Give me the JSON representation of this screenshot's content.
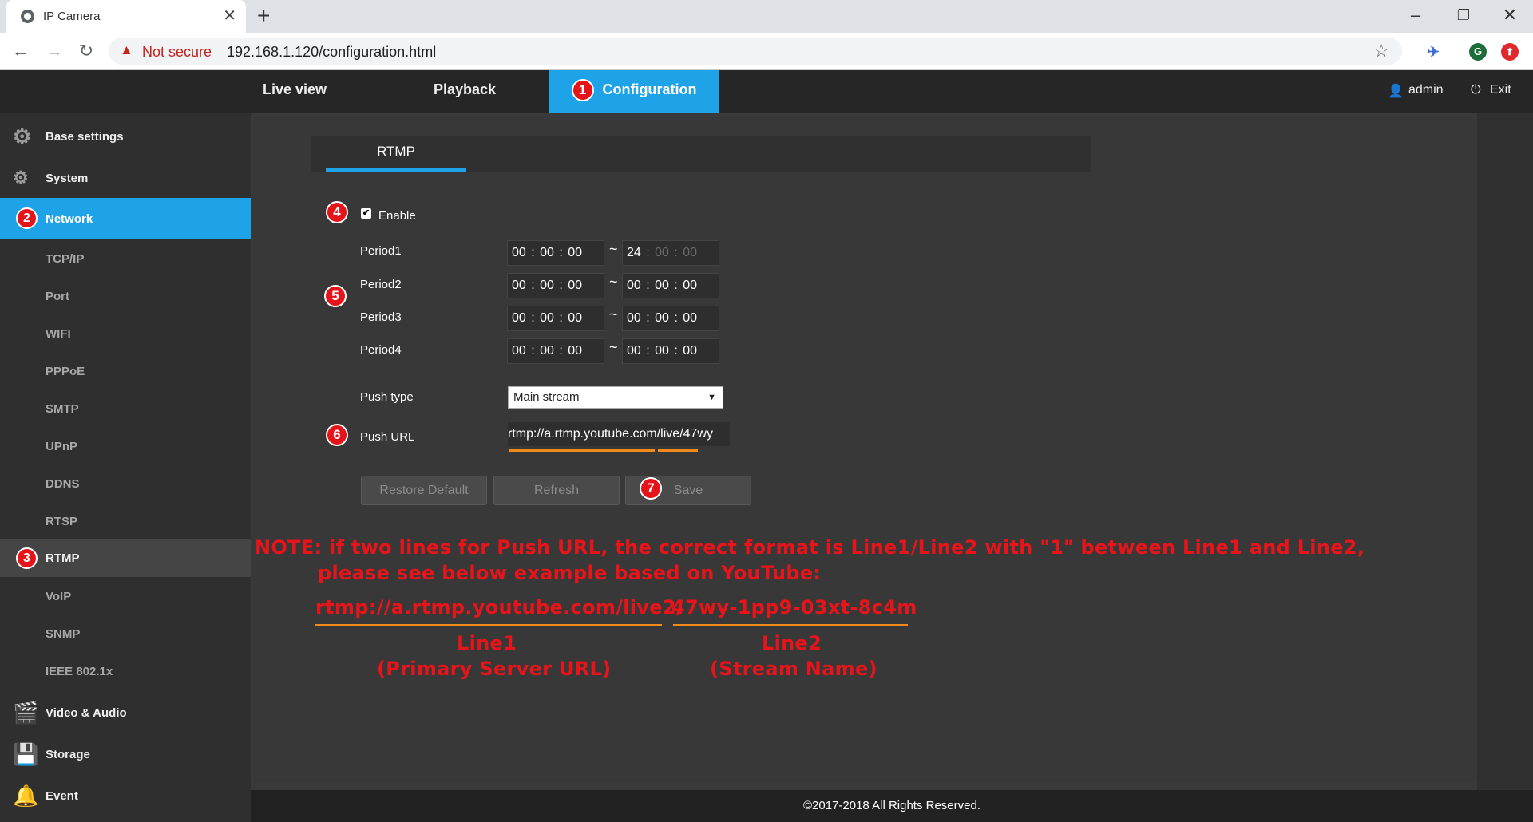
{
  "browser": {
    "tab_title": "IP Camera",
    "tab_close": "✕",
    "new_tab": "+",
    "not_secure": "Not secure",
    "url": "192.168.1.120/configuration.html",
    "ext_g": "G"
  },
  "header": {
    "nav": [
      {
        "label": "Live view"
      },
      {
        "label": "Playback"
      },
      {
        "label": "Configuration",
        "badge": "1"
      }
    ],
    "user": "admin",
    "exit": "Exit"
  },
  "sidebar": {
    "items": [
      {
        "label": "Base settings",
        "icon": "gear-icon"
      },
      {
        "label": "System",
        "icon": "gears-icon"
      },
      {
        "label": "Network",
        "badge": "2"
      },
      {
        "label": "RTMP",
        "badge": "3"
      },
      {
        "label": "Video & Audio",
        "icon": "film-icon"
      },
      {
        "label": "Storage",
        "icon": "disk-icon"
      },
      {
        "label": "Event",
        "icon": "bell-icon"
      }
    ],
    "network_sub": [
      "TCP/IP",
      "Port",
      "WIFI",
      "PPPoE",
      "SMTP",
      "UPnP",
      "DDNS",
      "RTSP"
    ],
    "rtmp_sub": [
      "VoIP",
      "SNMP",
      "IEEE 802.1x"
    ]
  },
  "main": {
    "tab": "RTMP",
    "enable_label": "Enable",
    "enable_checked": true,
    "periods": [
      {
        "label": "Period1",
        "start": "00 : 00 : 00",
        "end_h": "24",
        "end_rest": " : 00 : 00"
      },
      {
        "label": "Period2",
        "start": "00 : 00 : 00",
        "end": "00 : 00 : 00"
      },
      {
        "label": "Period3",
        "start": "00 : 00 : 00",
        "end": "00 : 00 : 00"
      },
      {
        "label": "Period4",
        "start": "00 : 00 : 00",
        "end": "00 : 00 : 00"
      }
    ],
    "tilde": "~",
    "push_type_label": "Push type",
    "push_type_value": "Main stream",
    "push_url_label": "Push URL",
    "push_url_value": "rtmp://a.rtmp.youtube.com/live/47wy",
    "buttons": {
      "restore": "Restore Default",
      "refresh": "Refresh",
      "save": "Save"
    },
    "badges": {
      "enable": "4",
      "periods": "5",
      "push_url": "6",
      "save": "7"
    }
  },
  "note": {
    "line1": "NOTE: if two lines for Push URL, the correct format is Line1/Line2 with \"1\" between Line1 and Line2,",
    "line2": "please see below example based on YouTube:",
    "example_part1": "rtmp://a.rtmp.youtube.com/live2/",
    "example_part2": "47wy-1pp9-03xt-8c4m",
    "line1_label": "Line1",
    "line1_desc": "(Primary Server URL)",
    "line2_label": "Line2",
    "line2_desc": "(Stream Name)"
  },
  "footer": "©2017-2018 All Rights Reserved.",
  "colors": {
    "accent": "#1ea3e8",
    "annotation": "#e4141a",
    "underline": "#f08a1c"
  }
}
